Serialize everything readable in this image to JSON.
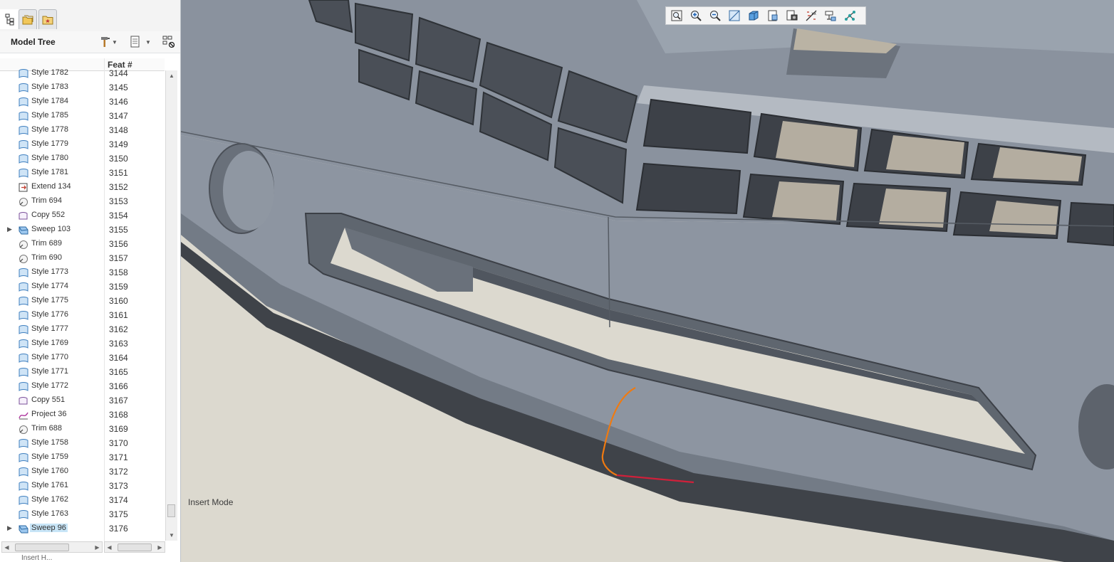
{
  "model_tree": {
    "title": "Model Tree",
    "column_header": "Feat #",
    "rows": [
      {
        "icon": "style",
        "label": "Style 1782",
        "feat": "3144",
        "expandable": false,
        "selected": false
      },
      {
        "icon": "style",
        "label": "Style 1783",
        "feat": "3145",
        "expandable": false,
        "selected": false
      },
      {
        "icon": "style",
        "label": "Style 1784",
        "feat": "3146",
        "expandable": false,
        "selected": false
      },
      {
        "icon": "style",
        "label": "Style 1785",
        "feat": "3147",
        "expandable": false,
        "selected": false
      },
      {
        "icon": "style",
        "label": "Style 1778",
        "feat": "3148",
        "expandable": false,
        "selected": false
      },
      {
        "icon": "style",
        "label": "Style 1779",
        "feat": "3149",
        "expandable": false,
        "selected": false
      },
      {
        "icon": "style",
        "label": "Style 1780",
        "feat": "3150",
        "expandable": false,
        "selected": false
      },
      {
        "icon": "style",
        "label": "Style 1781",
        "feat": "3151",
        "expandable": false,
        "selected": false
      },
      {
        "icon": "extend",
        "label": "Extend 134",
        "feat": "3152",
        "expandable": false,
        "selected": false
      },
      {
        "icon": "trim",
        "label": "Trim 694",
        "feat": "3153",
        "expandable": false,
        "selected": false
      },
      {
        "icon": "copy",
        "label": "Copy 552",
        "feat": "3154",
        "expandable": false,
        "selected": false
      },
      {
        "icon": "sweep",
        "label": "Sweep 103",
        "feat": "3155",
        "expandable": true,
        "selected": false
      },
      {
        "icon": "trim",
        "label": "Trim 689",
        "feat": "3156",
        "expandable": false,
        "selected": false
      },
      {
        "icon": "trim",
        "label": "Trim 690",
        "feat": "3157",
        "expandable": false,
        "selected": false
      },
      {
        "icon": "style",
        "label": "Style 1773",
        "feat": "3158",
        "expandable": false,
        "selected": false
      },
      {
        "icon": "style",
        "label": "Style 1774",
        "feat": "3159",
        "expandable": false,
        "selected": false
      },
      {
        "icon": "style",
        "label": "Style 1775",
        "feat": "3160",
        "expandable": false,
        "selected": false
      },
      {
        "icon": "style",
        "label": "Style 1776",
        "feat": "3161",
        "expandable": false,
        "selected": false
      },
      {
        "icon": "style",
        "label": "Style 1777",
        "feat": "3162",
        "expandable": false,
        "selected": false
      },
      {
        "icon": "style",
        "label": "Style 1769",
        "feat": "3163",
        "expandable": false,
        "selected": false
      },
      {
        "icon": "style",
        "label": "Style 1770",
        "feat": "3164",
        "expandable": false,
        "selected": false
      },
      {
        "icon": "style",
        "label": "Style 1771",
        "feat": "3165",
        "expandable": false,
        "selected": false
      },
      {
        "icon": "style",
        "label": "Style 1772",
        "feat": "3166",
        "expandable": false,
        "selected": false
      },
      {
        "icon": "copy",
        "label": "Copy 551",
        "feat": "3167",
        "expandable": false,
        "selected": false
      },
      {
        "icon": "project",
        "label": "Project 36",
        "feat": "3168",
        "expandable": false,
        "selected": false
      },
      {
        "icon": "trim",
        "label": "Trim 688",
        "feat": "3169",
        "expandable": false,
        "selected": false
      },
      {
        "icon": "style",
        "label": "Style 1758",
        "feat": "3170",
        "expandable": false,
        "selected": false
      },
      {
        "icon": "style",
        "label": "Style 1759",
        "feat": "3171",
        "expandable": false,
        "selected": false
      },
      {
        "icon": "style",
        "label": "Style 1760",
        "feat": "3172",
        "expandable": false,
        "selected": false
      },
      {
        "icon": "style",
        "label": "Style 1761",
        "feat": "3173",
        "expandable": false,
        "selected": false
      },
      {
        "icon": "style",
        "label": "Style 1762",
        "feat": "3174",
        "expandable": false,
        "selected": false
      },
      {
        "icon": "style",
        "label": "Style 1763",
        "feat": "3175",
        "expandable": false,
        "selected": false
      },
      {
        "icon": "sweep",
        "label": "Sweep 96",
        "feat": "3176",
        "expandable": true,
        "selected": true
      }
    ],
    "partial_row_label": "Insert H..."
  },
  "graphics": {
    "status_text": "Insert Mode",
    "toolbar_icons": [
      "refit-icon",
      "zoom-in-icon",
      "zoom-out-icon",
      "repaint-icon",
      "display-style-icon",
      "saved-views-icon",
      "view-manager-icon",
      "datum-display-icon",
      "annotation-display-icon",
      "spin-center-icon"
    ]
  },
  "colors": {
    "selection": "#c8e5f7",
    "background_floor": "#dcd9cf",
    "model_surface": "#8e96a2",
    "curve_orange": "#f07a10",
    "curve_red": "#d0203a"
  }
}
